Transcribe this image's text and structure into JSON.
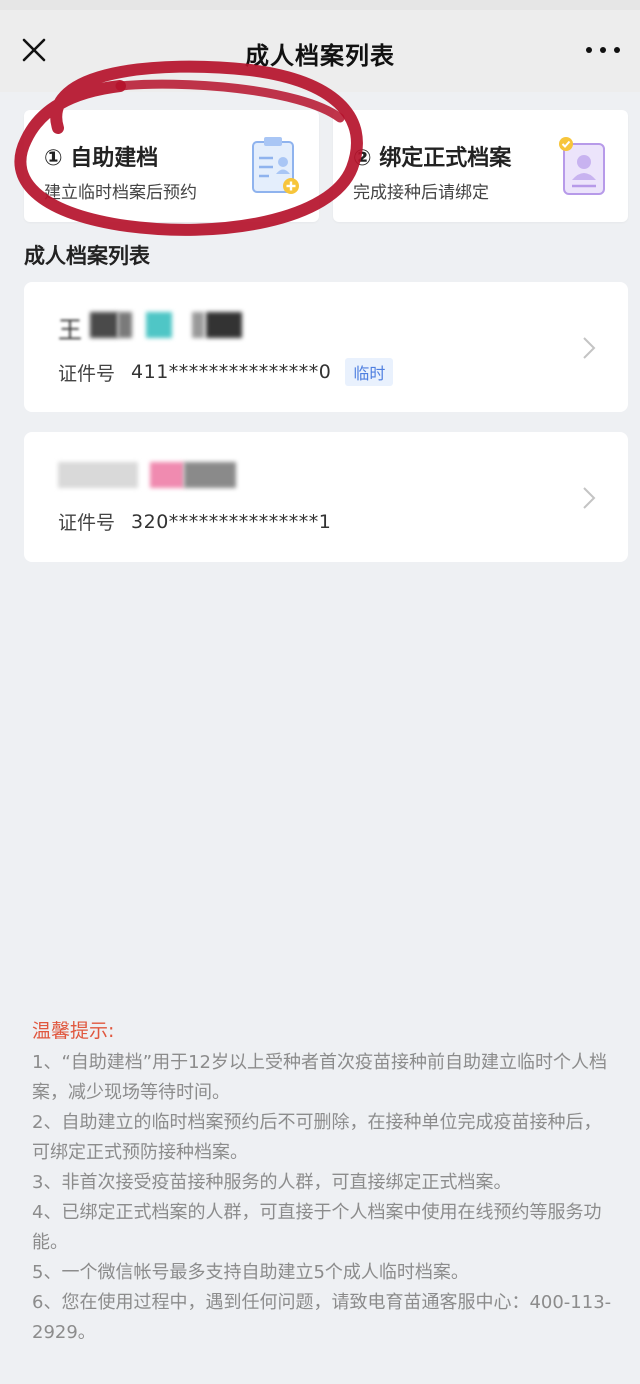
{
  "nav": {
    "title": "成人档案列表"
  },
  "entries": [
    {
      "title": "① 自助建档",
      "subtitle": "建立临时档案后预约",
      "icon": "clipboard-add-icon"
    },
    {
      "title": "② 绑定正式档案",
      "subtitle": "完成接种后请绑定",
      "icon": "id-card-icon"
    }
  ],
  "section_title": "成人档案列表",
  "records": [
    {
      "name": "王",
      "id_label": "证件号",
      "id_value": "411***************0",
      "tag": "临时"
    },
    {
      "name": "",
      "id_label": "证件号",
      "id_value": "320***************1",
      "tag": ""
    }
  ],
  "tips": {
    "title": "温馨提示:",
    "lines": [
      "1、“自助建档”用于12岁以上受种者首次疫苗接种前自助建立临时个人档案，减少现场等待时间。",
      "2、自助建立的临时档案预约后不可删除，在接种单位完成疫苗接种后，可绑定正式预防接种档案。",
      "3、非首次接受疫苗接种服务的人群，可直接绑定正式档案。",
      "4、已绑定正式档案的人群，可直接于个人档案中使用在线预约等服务功能。",
      "5、一个微信帐号最多支持自助建立5个成人临时档案。",
      "6、您在使用过程中，遇到任何问题，请致电育苗通客服中心：400-113-2929。"
    ]
  },
  "colors": {
    "annotation": "#b5122b",
    "tips_title": "#e0573e",
    "tag_text": "#4f7fe0",
    "tag_bg": "#e9f1fd"
  }
}
